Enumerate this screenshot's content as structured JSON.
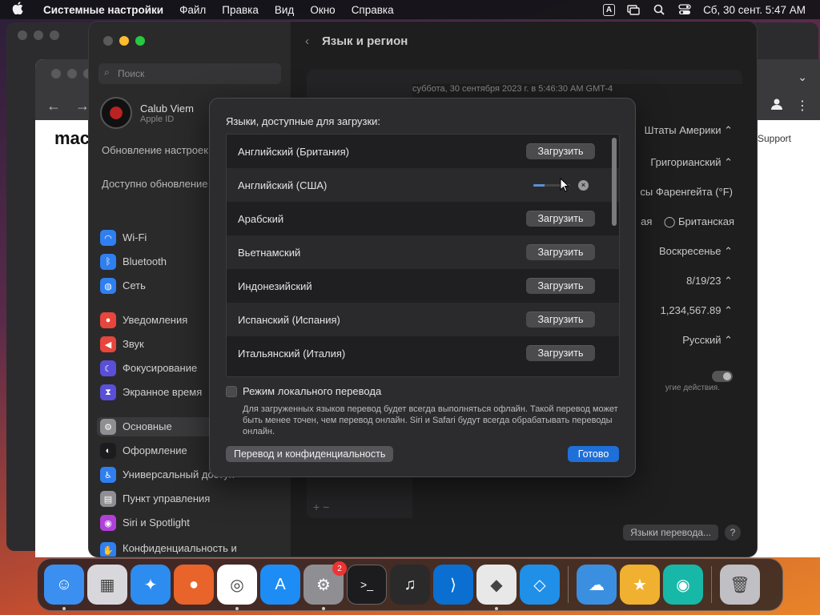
{
  "menubar": {
    "app_name": "Системные настройки",
    "items": [
      "Файл",
      "Правка",
      "Вид",
      "Окно",
      "Справка"
    ],
    "input_source": "A",
    "datetime": "Сб, 30 сент.  5:47 AM"
  },
  "browser": {
    "page_text": "mac",
    "support_link": "Support"
  },
  "sidebar": {
    "search_placeholder": "Поиск",
    "account_name": "Calub Viem",
    "account_sub": "Apple ID",
    "update_notice": "Обновление настроек Apple ID",
    "update_available": "Доступно обновление",
    "items": [
      {
        "label": "Wi-Fi",
        "icon": "wifi-icon",
        "color": "#2f7ff0"
      },
      {
        "label": "Bluetooth",
        "icon": "bluetooth-icon",
        "color": "#2f7ff0"
      },
      {
        "label": "Сеть",
        "icon": "globe-icon",
        "color": "#2f7ff0"
      },
      {
        "label": "Уведомления",
        "icon": "bell-icon",
        "color": "#e8453c"
      },
      {
        "label": "Звук",
        "icon": "speaker-icon",
        "color": "#e8453c"
      },
      {
        "label": "Фокусирование",
        "icon": "moon-icon",
        "color": "#5a4fd8"
      },
      {
        "label": "Экранное время",
        "icon": "hourglass-icon",
        "color": "#5a4fd8"
      },
      {
        "label": "Основные",
        "icon": "gear-icon",
        "color": "#8e8e93"
      },
      {
        "label": "Оформление",
        "icon": "appearance-icon",
        "color": "#1c1c1e"
      },
      {
        "label": "Универсальный доступ",
        "icon": "accessibility-icon",
        "color": "#2f7ff0"
      },
      {
        "label": "Пункт управления",
        "icon": "control-center-icon",
        "color": "#8e8e93"
      },
      {
        "label": "Siri и Spotlight",
        "icon": "siri-icon",
        "color": "#b040d8"
      },
      {
        "label": "Конфиденциальность и безопасность",
        "icon": "hand-icon",
        "color": "#2f7ff0"
      }
    ]
  },
  "content": {
    "back": "‹",
    "title": "Язык и регион",
    "date_line": "суббота, 30 сентября 2023 г. в 5:46:30 AM GMT-4",
    "region": "Штаты Америки",
    "calendar": "Григорианский",
    "temperature": "сы Фаренгейта (°F)",
    "measure_a": "ая",
    "measure_b": "Британская",
    "first_day": "Воскресенье",
    "date_format": "8/19/23",
    "number_format": "1,234,567.89",
    "list_order": "Русский",
    "toggle_note": "угие действия.",
    "plus_minus": "+  −",
    "translation_button": "Языки перевода...",
    "help": "?"
  },
  "modal": {
    "title": "Языки, доступные для загрузки:",
    "languages": [
      {
        "name": "Английский (Британия)",
        "action": "Загрузить"
      },
      {
        "name": "Английский (США)",
        "action": ""
      },
      {
        "name": "Арабский",
        "action": "Загрузить"
      },
      {
        "name": "Вьетнамский",
        "action": "Загрузить"
      },
      {
        "name": "Индонезийский",
        "action": "Загрузить"
      },
      {
        "name": "Испанский (Испания)",
        "action": "Загрузить"
      },
      {
        "name": "Итальянский (Италия)",
        "action": "Загрузить"
      }
    ],
    "download_progress": 0.3,
    "cancel_glyph": "×",
    "local_mode_label": "Режим локального перевода",
    "local_mode_desc": "Для загруженных языков перевод будет всегда выполняться офлайн. Такой перевод может быть менее точен, чем перевод онлайн. Siri и Safari будут всегда обрабатывать переводы онлайн.",
    "privacy_button": "Перевод и конфиденциальность",
    "done_button": "Готово"
  },
  "dock": {
    "apps": [
      {
        "name": "finder-icon",
        "color": "#3a8ff0",
        "running": true
      },
      {
        "name": "launchpad-icon",
        "color": "#d8d8dc",
        "running": false
      },
      {
        "name": "safari-icon",
        "color": "#2c8cf0",
        "running": false
      },
      {
        "name": "firefox-icon",
        "color": "#e8642a",
        "running": false
      },
      {
        "name": "chrome-icon",
        "color": "#ffffff",
        "running": true
      },
      {
        "name": "app-store-icon",
        "color": "#1d8cf5",
        "running": false
      },
      {
        "name": "system-settings-icon",
        "color": "#8e8e93",
        "running": true,
        "badge": "2"
      },
      {
        "name": "terminal-icon",
        "color": "#1c1c1e",
        "running": false
      },
      {
        "name": "garageband-icon",
        "color": "#2a2a2a",
        "running": false
      },
      {
        "name": "vscode-icon",
        "color": "#0a6fd0",
        "running": false
      },
      {
        "name": "roblox-icon",
        "color": "#e8e8e8",
        "running": true
      },
      {
        "name": "roblox-studio-icon",
        "color": "#1f8fe8",
        "running": false
      },
      {
        "name": "weather-icon",
        "color": "#3b8fe0",
        "running": false
      },
      {
        "name": "game-icon",
        "color": "#f0b030",
        "running": false
      },
      {
        "name": "camera-icon",
        "color": "#18b8a8",
        "running": false
      },
      {
        "name": "trash-icon",
        "color": "#bfbfc4",
        "running": false
      }
    ]
  },
  "colors": {
    "accent": "#1f6fd8",
    "close": "#ff5f57",
    "minimize": "#febc2e",
    "zoom": "#28c840"
  }
}
